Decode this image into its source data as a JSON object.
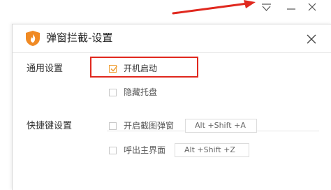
{
  "colors": {
    "accent": "#f0a23a",
    "annotation": "#e0281e",
    "text": "#333333",
    "border": "#dcdcdc"
  },
  "parent_window": {
    "buttons": [
      "dropdown-menu-icon",
      "minimize-icon",
      "close-icon"
    ]
  },
  "dialog": {
    "title": "弹窗拦截-设置",
    "logo_icon": "shield-logo-icon",
    "close_icon": "close-icon"
  },
  "general": {
    "section_label": "通用设置",
    "options": [
      {
        "label": "开机启动",
        "checked": true
      },
      {
        "label": "隐藏托盘",
        "checked": false
      }
    ]
  },
  "hotkeys": {
    "section_label": "快捷键设置",
    "items": [
      {
        "label": "开启截图弹窗",
        "enabled": false,
        "shortcut": "Alt +Shift +A"
      },
      {
        "label": "呼出主界面",
        "enabled": false,
        "shortcut": "Alt +Shift +Z"
      }
    ]
  }
}
